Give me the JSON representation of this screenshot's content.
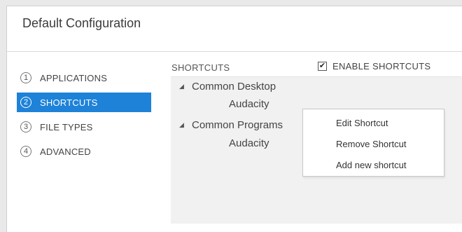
{
  "window": {
    "title": "Default Configuration"
  },
  "nav": {
    "items": [
      {
        "num": "1",
        "label": "APPLICATIONS"
      },
      {
        "num": "2",
        "label": "SHORTCUTS"
      },
      {
        "num": "3",
        "label": "FILE TYPES"
      },
      {
        "num": "4",
        "label": "ADVANCED"
      }
    ],
    "active_index": 1,
    "active_color": "#1e82d8"
  },
  "panel": {
    "title": "SHORTCUTS",
    "enable_label": "ENABLE SHORTCUTS",
    "enable_checked": true,
    "check_glyph": "✔"
  },
  "tree": {
    "expand_glyph": "◢",
    "groups": [
      {
        "label": "Common Desktop",
        "children": [
          "Audacity"
        ]
      },
      {
        "label": "Common Programs",
        "children": [
          "Audacity"
        ]
      }
    ]
  },
  "context_menu": {
    "items": [
      "Edit Shortcut",
      "Remove Shortcut",
      "Add new shortcut"
    ]
  }
}
